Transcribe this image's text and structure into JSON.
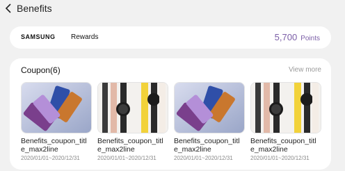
{
  "header": {
    "title": "Benefits",
    "back_icon": "chevron-left-icon"
  },
  "rewards": {
    "brand": "SAMSUNG",
    "label": "Rewards",
    "points": "5,700",
    "points_unit": "Points",
    "accent_color": "#7b5ea7"
  },
  "coupons": {
    "heading": "Coupon(6)",
    "view_more": "View more",
    "items": [
      {
        "name": "Benefits_coupon_title_max2line",
        "date": "2020/01/01~2020/12/31",
        "image": "phones-image"
      },
      {
        "name": "Benefits_coupon_title_max2line",
        "date": "2020/01/01~2020/12/31",
        "image": "watches-image"
      },
      {
        "name": "Benefits_coupon_title_max2line",
        "date": "2020/01/01~2020/12/31",
        "image": "phones-image"
      },
      {
        "name": "Benefits_coupon_title_max2line",
        "date": "2020/01/01~2020/12/31",
        "image": "watches-image"
      }
    ]
  }
}
